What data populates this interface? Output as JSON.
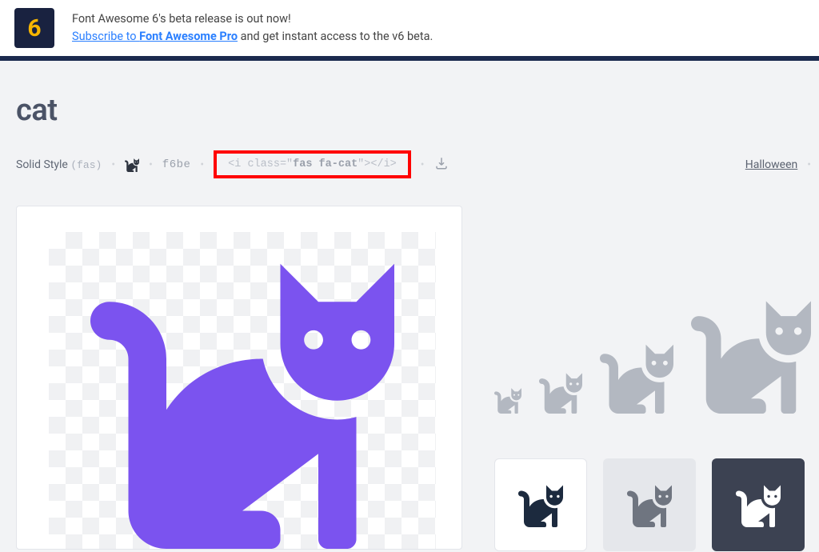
{
  "banner": {
    "badge": "6",
    "line1": "Font Awesome 6's beta release is out now!",
    "link_pre": "Subscribe to ",
    "link_strong": "Font Awesome Pro",
    "line2_rest": " and get instant access to the v6 beta."
  },
  "icon": {
    "title": "cat",
    "style_label": "Solid Style",
    "style_code": "(fas)",
    "unicode": "f6be",
    "snippet_prefix": "<i class=\"",
    "snippet_class": "fas fa-cat",
    "snippet_suffix": "\"></i>",
    "category": "Halloween"
  },
  "colors": {
    "accent": "#7b53ef",
    "grey": "#b3b8c1",
    "dark": "#1c2a3e"
  }
}
